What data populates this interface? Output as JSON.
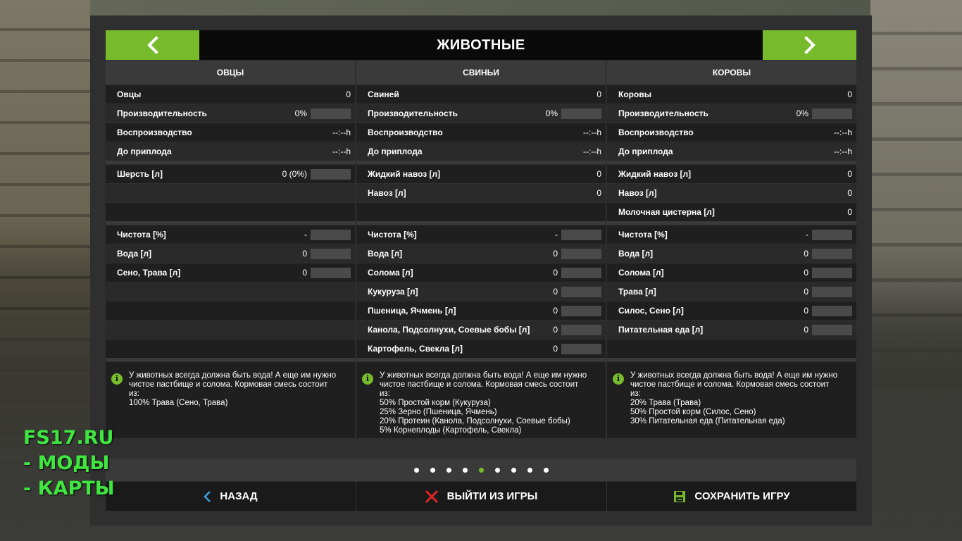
{
  "header": {
    "title": "ЖИВОТНЫЕ"
  },
  "columns": [
    {
      "title": "ОВЦЫ",
      "stats": [
        {
          "label": "Овцы",
          "value": "0",
          "bar": false
        },
        {
          "label": "Производительность",
          "value": "0%",
          "bar": true
        },
        {
          "label": "Воспроизводство",
          "value": "--:--h",
          "bar": false
        },
        {
          "label": "До приплода",
          "value": "--:--h",
          "bar": false
        }
      ],
      "products": [
        {
          "label": "Шерсть [л]",
          "value": "0 (0%)",
          "bar": true
        },
        {
          "label": "",
          "value": "",
          "bar": false
        },
        {
          "label": "",
          "value": "",
          "bar": false
        }
      ],
      "needs": [
        {
          "label": "Чистота [%]",
          "value": "-",
          "bar": true
        },
        {
          "label": "Вода [л]",
          "value": "0",
          "bar": true
        },
        {
          "label": "Сено, Трава [л]",
          "value": "0",
          "bar": true
        },
        {
          "label": "",
          "value": "",
          "bar": false
        },
        {
          "label": "",
          "value": "",
          "bar": false
        },
        {
          "label": "",
          "value": "",
          "bar": false
        },
        {
          "label": "",
          "value": "",
          "bar": false
        }
      ],
      "info": "У животных всегда должна быть вода! А еще им нужно\nчистое пастбище и солома. Кормовая смесь состоит\nиз:\n100% Трава (Сено, Трава)"
    },
    {
      "title": "СВИНЬИ",
      "stats": [
        {
          "label": "Свиней",
          "value": "0",
          "bar": false
        },
        {
          "label": "Производительность",
          "value": "0%",
          "bar": true
        },
        {
          "label": "Воспроизводство",
          "value": "--:--h",
          "bar": false
        },
        {
          "label": "До приплода",
          "value": "--:--h",
          "bar": false
        }
      ],
      "products": [
        {
          "label": "Жидкий навоз [л]",
          "value": "0",
          "bar": false
        },
        {
          "label": "Навоз [л]",
          "value": "0",
          "bar": false
        },
        {
          "label": "",
          "value": "",
          "bar": false
        }
      ],
      "needs": [
        {
          "label": "Чистота [%]",
          "value": "-",
          "bar": true
        },
        {
          "label": "Вода [л]",
          "value": "0",
          "bar": true
        },
        {
          "label": "Солома [л]",
          "value": "0",
          "bar": true
        },
        {
          "label": "Кукуруза [л]",
          "value": "0",
          "bar": true
        },
        {
          "label": "Пшеница, Ячмень [л]",
          "value": "0",
          "bar": true
        },
        {
          "label": "Канола, Подсолнухи, Соевые бобы [л]",
          "value": "0",
          "bar": true
        },
        {
          "label": "Картофель, Свекла [л]",
          "value": "0",
          "bar": true
        }
      ],
      "info": "У животных всегда должна быть вода! А еще им нужно\nчистое пастбище и солома. Кормовая смесь состоит\nиз:\n50% Простой корм (Кукуруза)\n25% Зерно (Пшеница, Ячмень)\n20% Протеин (Канола, Подсолнухи, Соевые бобы)\n5% Корнеплоды (Картофель, Свекла)"
    },
    {
      "title": "КОРОВЫ",
      "stats": [
        {
          "label": "Коровы",
          "value": "0",
          "bar": false
        },
        {
          "label": "Производительность",
          "value": "0%",
          "bar": true
        },
        {
          "label": "Воспроизводство",
          "value": "--:--h",
          "bar": false
        },
        {
          "label": "До приплода",
          "value": "--:--h",
          "bar": false
        }
      ],
      "products": [
        {
          "label": "Жидкий навоз [л]",
          "value": "0",
          "bar": false
        },
        {
          "label": "Навоз [л]",
          "value": "0",
          "bar": false
        },
        {
          "label": "Молочная цистерна [л]",
          "value": "0",
          "bar": false
        }
      ],
      "needs": [
        {
          "label": "Чистота [%]",
          "value": "-",
          "bar": true
        },
        {
          "label": "Вода [л]",
          "value": "0",
          "bar": true
        },
        {
          "label": "Солома [л]",
          "value": "0",
          "bar": true
        },
        {
          "label": "Трава [л]",
          "value": "0",
          "bar": true
        },
        {
          "label": "Силос, Сено [л]",
          "value": "0",
          "bar": true
        },
        {
          "label": "Питательная еда [л]",
          "value": "0",
          "bar": true
        },
        {
          "label": "",
          "value": "",
          "bar": false
        }
      ],
      "info": "У животных всегда должна быть вода! А еще им нужно\nчистое пастбище и солома. Кормовая смесь состоит\nиз:\n20% Трава (Трава)\n50% Простой корм (Силос, Сено)\n30% Питательная еда (Питательная еда)"
    }
  ],
  "pager": {
    "count": 9,
    "active_index": 4
  },
  "footer": {
    "back_label": "НАЗАД",
    "quit_label": "ВЫЙТИ ИЗ ИГРЫ",
    "save_label": "СОХРАНИТЬ ИГРУ"
  },
  "watermark": {
    "line1": "FS17.RU",
    "line2": "- МОДЫ",
    "line3": "- КАРТЫ"
  },
  "colors": {
    "accent": "#77bb2d",
    "quit": "#e02424",
    "back": "#3aa0e0"
  },
  "icons": {
    "prev": "chevron-left-icon",
    "next": "chevron-right-icon",
    "info": "info-icon",
    "back": "back-arrow-icon",
    "quit": "close-x-icon",
    "save": "floppy-disk-icon"
  }
}
